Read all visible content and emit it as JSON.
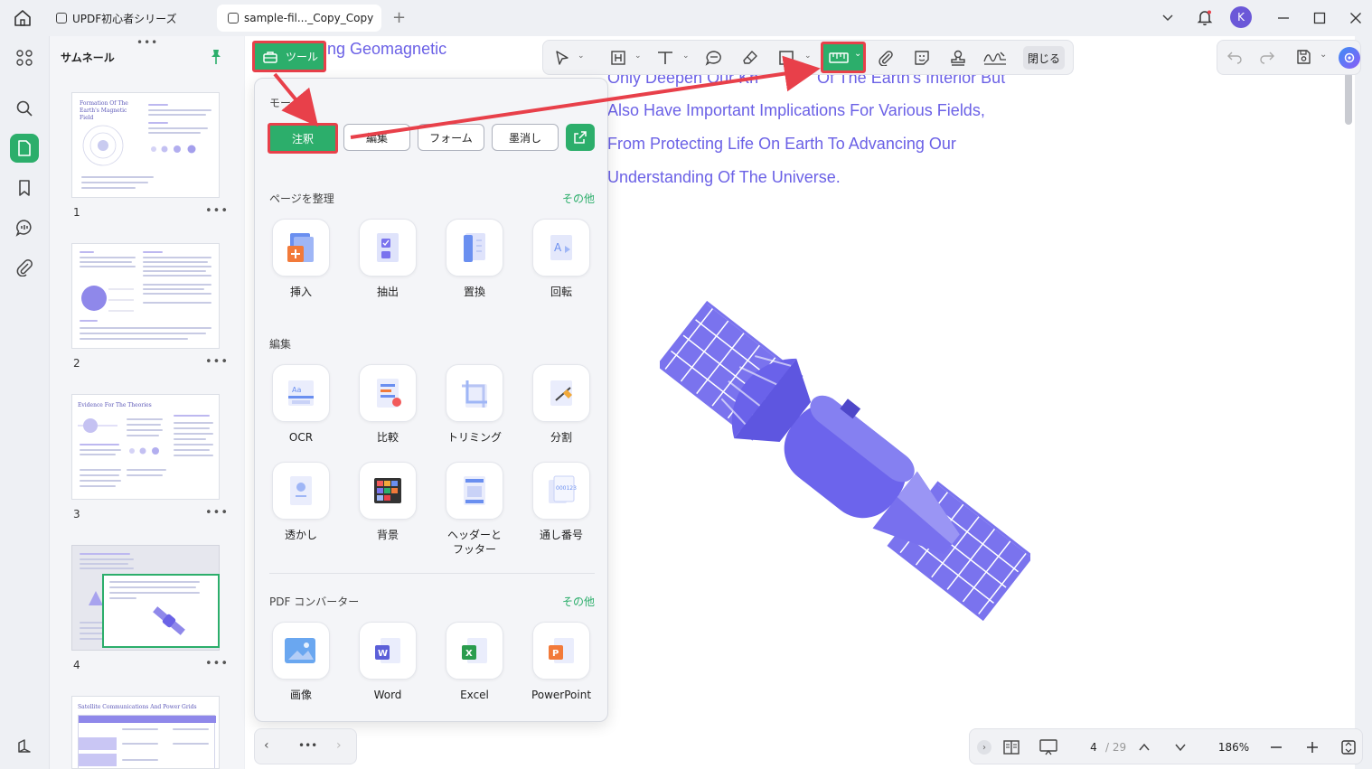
{
  "tabs": [
    {
      "label": "UPDF初心者シリーズ"
    },
    {
      "label": "sample-fil..._Copy_Copy"
    }
  ],
  "user_avatar": "K",
  "thumbnails": {
    "title": "サムネール",
    "pages": [
      {
        "num": "1",
        "title": "Formation Of The Earth's Magnetic Field"
      },
      {
        "num": "2"
      },
      {
        "num": "3",
        "title": "Evidence For The Theories"
      },
      {
        "num": "4"
      },
      {
        "num": "",
        "title": "Satellite Communications And Power Grids"
      }
    ]
  },
  "doc": {
    "heading_fragment": "ng Geomagnetic",
    "lines": [
      "Only Deepen Our Kn",
      "Of The Earth's Interior But",
      "Also Have Important Implications For Various Fields,",
      "From Protecting Life On Earth To Advancing Our",
      "Understanding Of The Universe."
    ]
  },
  "toolbar": {
    "close_label": "閉じる"
  },
  "tools_button": {
    "label": "ツール"
  },
  "popover": {
    "mode_title": "モー",
    "modes": [
      "注釈",
      "編集",
      "フォーム",
      "墨消し"
    ],
    "organize": {
      "title": "ページを整理",
      "more": "その他",
      "items": [
        "挿入",
        "抽出",
        "置換",
        "回転"
      ]
    },
    "edit": {
      "title": "編集",
      "items": [
        "OCR",
        "比較",
        "トリミング",
        "分割",
        "透かし",
        "背景",
        "ヘッダーと\nフッター",
        "通し番号"
      ]
    },
    "converter": {
      "title": "PDF コンバーター",
      "more": "その他",
      "items": [
        "画像",
        "Word",
        "Excel",
        "PowerPoint"
      ]
    }
  },
  "pagination": {
    "current": "4",
    "total": "/ 29",
    "zoom": "186%"
  },
  "colors": {
    "accent_green": "#2cae6b",
    "highlight_red": "#e8404a",
    "doc_text": "#6b61e6",
    "satellite": "#7a73ee"
  }
}
